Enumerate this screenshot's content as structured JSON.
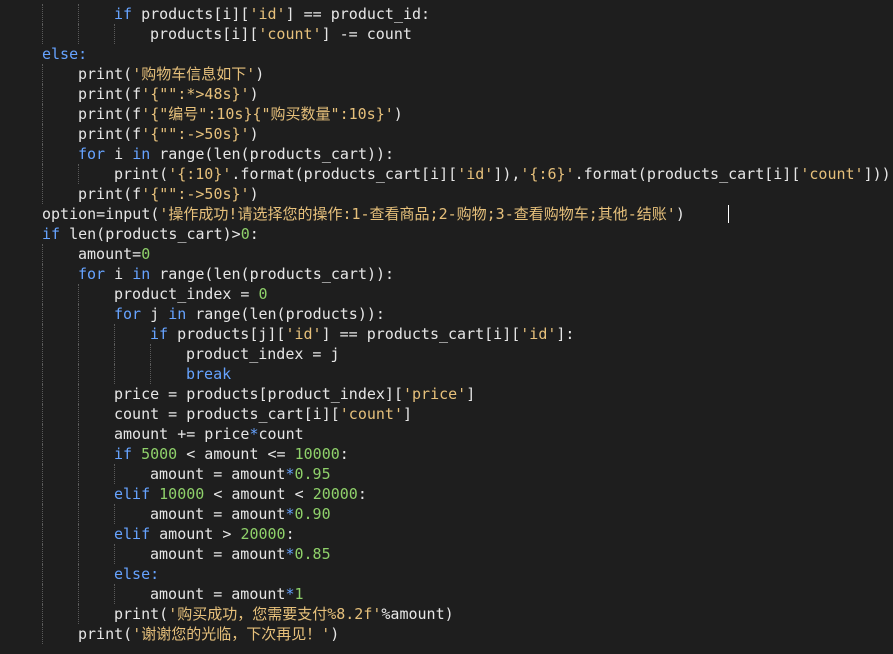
{
  "lines": [
    {
      "indent": 2,
      "tokens": [
        [
          "kw",
          "if "
        ],
        [
          "fn",
          "products["
        ],
        [
          "fn",
          "i"
        ],
        [
          "fn",
          "]["
        ],
        [
          "str",
          "'id'"
        ],
        [
          "fn",
          "] == product_id:"
        ]
      ]
    },
    {
      "indent": 3,
      "tokens": [
        [
          "fn",
          "products["
        ],
        [
          "fn",
          "i"
        ],
        [
          "fn",
          "]["
        ],
        [
          "str",
          "'count'"
        ],
        [
          "fn",
          "] -= count"
        ]
      ]
    },
    {
      "indent": 0,
      "tokens": [
        [
          "kw",
          "else:"
        ]
      ]
    },
    {
      "indent": 1,
      "tokens": [
        [
          "fn",
          "print("
        ],
        [
          "str",
          "'购物车信息如下'"
        ],
        [
          "fn",
          ")"
        ]
      ]
    },
    {
      "indent": 1,
      "tokens": [
        [
          "fn",
          "print(f"
        ],
        [
          "str",
          "'{\"\":*>48s}'"
        ],
        [
          "fn",
          ")"
        ]
      ]
    },
    {
      "indent": 1,
      "tokens": [
        [
          "fn",
          "print(f"
        ],
        [
          "str",
          "'{\"编号\":10s}{\"购买数量\":10s}'"
        ],
        [
          "fn",
          ")"
        ]
      ]
    },
    {
      "indent": 1,
      "tokens": [
        [
          "fn",
          "print(f"
        ],
        [
          "str",
          "'{\"\":->50s}'"
        ],
        [
          "fn",
          ")"
        ]
      ]
    },
    {
      "indent": 1,
      "tokens": [
        [
          "kw",
          "for "
        ],
        [
          "fn",
          "i "
        ],
        [
          "kw",
          "in "
        ],
        [
          "fn",
          "range(len(products_cart)):"
        ]
      ]
    },
    {
      "indent": 2,
      "tokens": [
        [
          "fn",
          "print("
        ],
        [
          "str",
          "'{:10}'"
        ],
        [
          "fn",
          ".format(products_cart[i]["
        ],
        [
          "str",
          "'id'"
        ],
        [
          "fn",
          "]),"
        ],
        [
          "str",
          "'{:6}'"
        ],
        [
          "fn",
          ".format(products_cart[i]["
        ],
        [
          "str",
          "'count'"
        ],
        [
          "fn",
          "]))"
        ]
      ]
    },
    {
      "indent": 1,
      "tokens": [
        [
          "fn",
          "print(f"
        ],
        [
          "str",
          "'{\"\":->50s}'"
        ],
        [
          "fn",
          ")"
        ]
      ]
    },
    {
      "indent": 0,
      "tokens": [
        [
          "fn",
          "option=input("
        ],
        [
          "str",
          "'操作成功!请选择您的操作:1-查看商品;2-购物;3-查看购物车;其他-结账'"
        ],
        [
          "fn",
          ")"
        ]
      ]
    },
    {
      "indent": 0,
      "tokens": [
        [
          "kw",
          "if "
        ],
        [
          "fn",
          "len(products_cart)>"
        ],
        [
          "num",
          "0"
        ],
        [
          "fn",
          ":"
        ]
      ]
    },
    {
      "indent": 1,
      "tokens": [
        [
          "fn",
          "amount="
        ],
        [
          "num",
          "0"
        ]
      ]
    },
    {
      "indent": 1,
      "tokens": [
        [
          "kw",
          "for "
        ],
        [
          "fn",
          "i "
        ],
        [
          "kw",
          "in "
        ],
        [
          "fn",
          "range(len(products_cart)):"
        ]
      ]
    },
    {
      "indent": 2,
      "tokens": [
        [
          "fn",
          "product_index = "
        ],
        [
          "num",
          "0"
        ]
      ]
    },
    {
      "indent": 2,
      "tokens": [
        [
          "kw",
          "for "
        ],
        [
          "fn",
          "j "
        ],
        [
          "kw",
          "in "
        ],
        [
          "fn",
          "range(len(products)):"
        ]
      ]
    },
    {
      "indent": 3,
      "tokens": [
        [
          "kw",
          "if "
        ],
        [
          "fn",
          "products[j]["
        ],
        [
          "str",
          "'id'"
        ],
        [
          "fn",
          "] == products_cart[i]["
        ],
        [
          "str",
          "'id'"
        ],
        [
          "fn",
          "]:"
        ]
      ]
    },
    {
      "indent": 4,
      "tokens": [
        [
          "fn",
          "product_index = j"
        ]
      ]
    },
    {
      "indent": 4,
      "tokens": [
        [
          "kw",
          "break"
        ]
      ]
    },
    {
      "indent": 2,
      "tokens": [
        [
          "fn",
          "price = products[product_index]["
        ],
        [
          "str",
          "'price'"
        ],
        [
          "fn",
          "]"
        ]
      ]
    },
    {
      "indent": 2,
      "tokens": [
        [
          "fn",
          "count = products_cart[i]["
        ],
        [
          "str",
          "'count'"
        ],
        [
          "fn",
          "]"
        ]
      ]
    },
    {
      "indent": 2,
      "tokens": [
        [
          "fn",
          "amount += price"
        ],
        [
          "kw",
          "*"
        ],
        [
          "fn",
          "count"
        ]
      ]
    },
    {
      "indent": 2,
      "tokens": [
        [
          "kw",
          "if "
        ],
        [
          "num",
          "5000"
        ],
        [
          "fn",
          " < amount <= "
        ],
        [
          "num",
          "10000"
        ],
        [
          "fn",
          ":"
        ]
      ]
    },
    {
      "indent": 3,
      "tokens": [
        [
          "fn",
          "amount = amount"
        ],
        [
          "kw",
          "*"
        ],
        [
          "num",
          "0.95"
        ]
      ]
    },
    {
      "indent": 2,
      "tokens": [
        [
          "kw",
          "elif "
        ],
        [
          "num",
          "10000"
        ],
        [
          "fn",
          " < amount < "
        ],
        [
          "num",
          "20000"
        ],
        [
          "fn",
          ":"
        ]
      ]
    },
    {
      "indent": 3,
      "tokens": [
        [
          "fn",
          "amount = amount"
        ],
        [
          "kw",
          "*"
        ],
        [
          "num",
          "0.90"
        ]
      ]
    },
    {
      "indent": 2,
      "tokens": [
        [
          "kw",
          "elif "
        ],
        [
          "fn",
          "amount > "
        ],
        [
          "num",
          "20000"
        ],
        [
          "fn",
          ":"
        ]
      ]
    },
    {
      "indent": 3,
      "tokens": [
        [
          "fn",
          "amount = amount"
        ],
        [
          "kw",
          "*"
        ],
        [
          "num",
          "0.85"
        ]
      ]
    },
    {
      "indent": 2,
      "tokens": [
        [
          "kw",
          "else:"
        ]
      ]
    },
    {
      "indent": 3,
      "tokens": [
        [
          "fn",
          "amount = amount"
        ],
        [
          "kw",
          "*"
        ],
        [
          "num",
          "1"
        ]
      ]
    },
    {
      "indent": 2,
      "tokens": [
        [
          "fn",
          "print("
        ],
        [
          "str",
          "'购买成功，您需要支付%8.2f'"
        ],
        [
          "fn",
          "%amount)"
        ]
      ]
    },
    {
      "indent": 1,
      "tokens": [
        [
          "fn",
          "print("
        ],
        [
          "str",
          "'谢谢您的光临，下次再见！'"
        ],
        [
          "fn",
          ")"
        ]
      ]
    }
  ],
  "colors": {
    "background": "#1e1e1e",
    "keyword": "#66a3ff",
    "string": "#e6c07b",
    "number": "#8fd16a",
    "text": "#e6e6e6"
  }
}
